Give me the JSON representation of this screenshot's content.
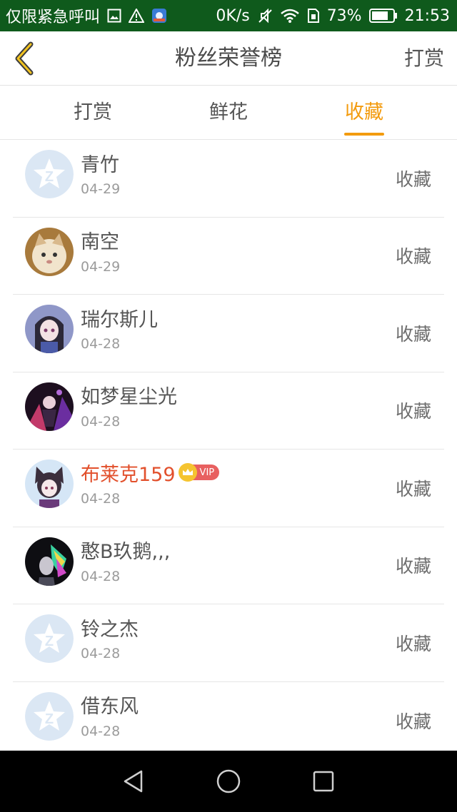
{
  "status_bar": {
    "carrier_text": "仅限紧急呼叫",
    "network_speed": "0K/s",
    "battery_percent": "73%",
    "time": "21:53",
    "icons": [
      "image-icon",
      "warning-icon",
      "app-notification-icon",
      "mute-icon",
      "wifi-icon",
      "sim-icon",
      "battery-icon"
    ]
  },
  "header": {
    "title": "粉丝荣誉榜",
    "action_label": "打赏",
    "back_icon": "chevron-left-icon",
    "accent_color": "#f39b0e"
  },
  "tabs": [
    {
      "label": "打赏",
      "active": false
    },
    {
      "label": "鲜花",
      "active": false
    },
    {
      "label": "收藏",
      "active": true
    }
  ],
  "list": {
    "items": [
      {
        "name": "青竹",
        "date": "04-29",
        "action": "收藏",
        "avatar": "default"
      },
      {
        "name": "南空",
        "date": "04-29",
        "action": "收藏",
        "avatar": "cat"
      },
      {
        "name": "瑞尔斯儿",
        "date": "04-28",
        "action": "收藏",
        "avatar": "anime-girl"
      },
      {
        "name": "如梦星尘光",
        "date": "04-28",
        "action": "收藏",
        "avatar": "dark-anime"
      },
      {
        "name": "布莱克159",
        "date": "04-28",
        "action": "收藏",
        "avatar": "cat-eared",
        "vip": true,
        "vip_label": "VIP"
      },
      {
        "name": "憨B玖鹅,,,",
        "date": "04-28",
        "action": "收藏",
        "avatar": "neon"
      },
      {
        "name": "铃之杰",
        "date": "04-28",
        "action": "收藏",
        "avatar": "default"
      },
      {
        "name": "借东风",
        "date": "04-28",
        "action": "收藏",
        "avatar": "default"
      }
    ]
  },
  "system_nav": {
    "icons": [
      "back-triangle-icon",
      "home-circle-icon",
      "recents-square-icon"
    ]
  }
}
